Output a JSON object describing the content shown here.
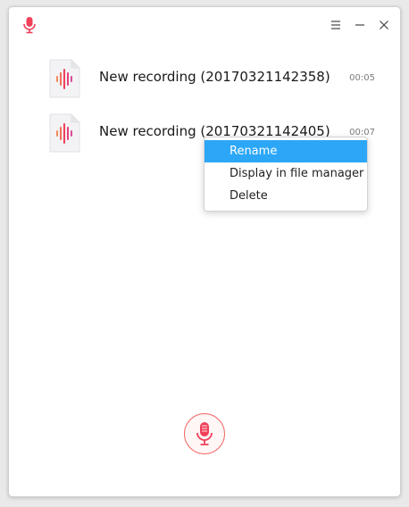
{
  "titlebar": {
    "app_icon": "microphone-icon",
    "buttons": [
      "menu-icon",
      "minimize-icon",
      "close-icon"
    ]
  },
  "recordings": [
    {
      "name": "New recording (20170321142358)",
      "duration": "00:05",
      "icon": "audio-file-icon"
    },
    {
      "name": "New recording (20170321142405)",
      "duration": "00:07",
      "icon": "audio-file-icon"
    }
  ],
  "context_menu": {
    "items": [
      {
        "label": "Rename",
        "active": true
      },
      {
        "label": "Display in file manager",
        "active": false
      },
      {
        "label": "Delete",
        "active": false
      }
    ]
  },
  "record_button": {
    "icon": "microphone-icon"
  },
  "colors": {
    "accent": "#2ca7f8",
    "brand": "#f0405a",
    "record_border": "#f26b6b"
  }
}
